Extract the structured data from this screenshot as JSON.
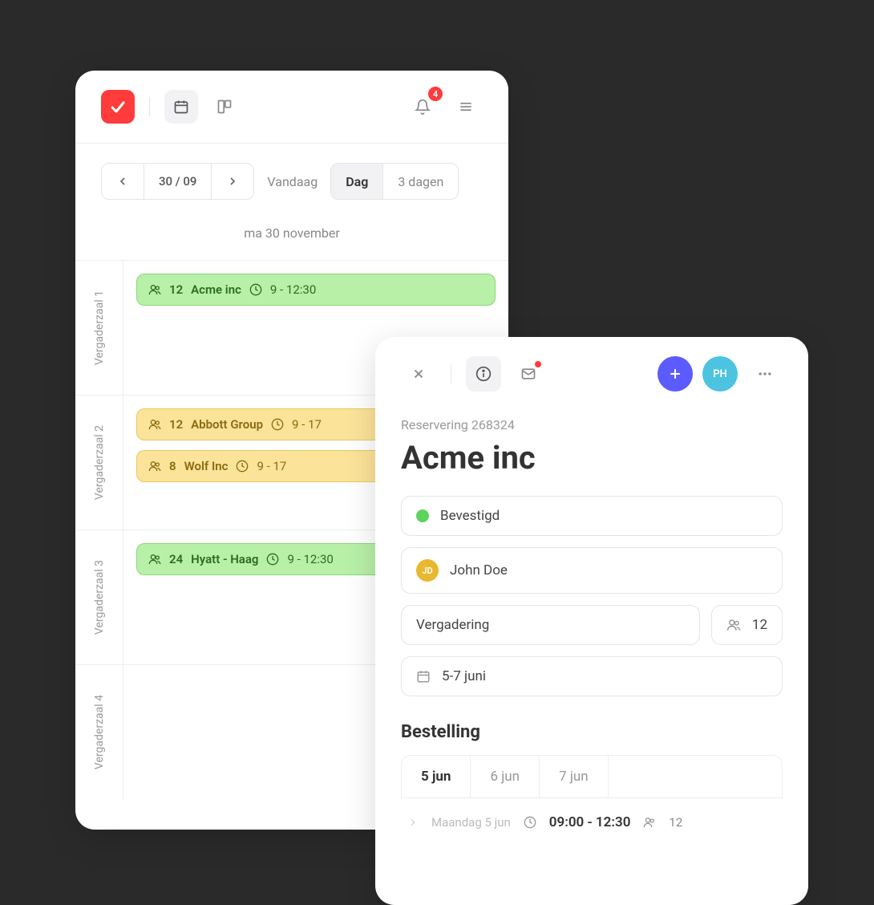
{
  "header": {
    "notification_count": "4"
  },
  "calendar": {
    "current_date": "30 / 09",
    "today_label": "Vandaag",
    "view_day": "Dag",
    "view_3days": "3 dagen",
    "date_heading": "ma 30 november",
    "rooms": [
      {
        "label": "Vergaderzaal 1",
        "events": [
          {
            "color": "green",
            "people": "12",
            "name": "Acme inc",
            "time": "9 - 12:30"
          }
        ]
      },
      {
        "label": "Vergaderzaal 2",
        "events": [
          {
            "color": "yellow",
            "people": "12",
            "name": "Abbott Group",
            "time": "9 - 17"
          },
          {
            "color": "yellow",
            "people": "8",
            "name": "Wolf Inc",
            "time": "9 - 17"
          }
        ]
      },
      {
        "label": "Vergaderzaal 3",
        "events": [
          {
            "color": "green",
            "people": "24",
            "name": "Hyatt - Haag",
            "time": "9 - 12:30"
          }
        ]
      },
      {
        "label": "Vergaderzaal 4",
        "events": []
      }
    ]
  },
  "detail": {
    "reservation_label": "Reservering 268324",
    "title": "Acme inc",
    "status": "Bevestigd",
    "contact_initials": "JD",
    "contact_name": "John Doe",
    "type": "Vergadering",
    "people_count": "12",
    "date_range": "5-7 juni",
    "avatar_initials": "PH",
    "order_heading": "Bestelling",
    "tabs": [
      "5 jun",
      "6 jun",
      "7 jun"
    ],
    "order_row": {
      "day": "Maandag 5 jun",
      "time": "09:00 - 12:30",
      "people": "12"
    }
  }
}
